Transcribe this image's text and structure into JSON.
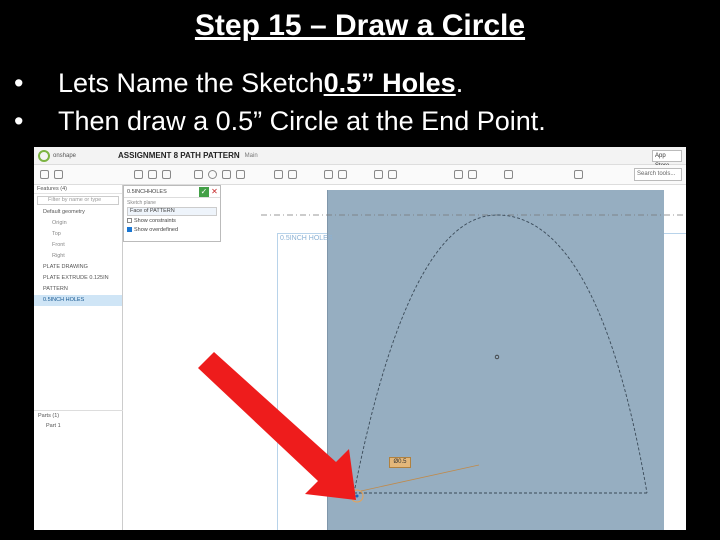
{
  "slide": {
    "title": "Step 15 – Draw a Circle",
    "bullet1_pre": "Lets Name the Sketch ",
    "bullet1_strong": "0.5” Holes",
    "bullet1_post": ".",
    "bullet2": "Then draw a 0.5” Circle at the End Point.",
    "bullet_symbol": "•"
  },
  "app": {
    "logo_text": "onshape",
    "doc_title": "ASSIGNMENT 8 PATH PATTERN",
    "workspace": "Main",
    "app_store": "App Store",
    "search_tools": "Search tools..."
  },
  "features": {
    "header": "Features (4)",
    "filter_placeholder": "Filter by name or type",
    "items": [
      "Default geometry",
      "Origin",
      "Top",
      "Front",
      "Right",
      "PLATE DRAWING",
      "PLATE EXTRUDE 0.125IN",
      "PATTERN",
      "0.5INCH HOLES"
    ],
    "parts_header": "Parts (1)",
    "parts": [
      "Part 1"
    ]
  },
  "sketch_dialog": {
    "title": "0.5INCHHOLES",
    "plane_label": "Sketch plane",
    "plane_value": "Face of PATTERN",
    "option1": "Show constraints",
    "option2": "Show overdefined"
  },
  "viewport": {
    "sketch_label": "0.5INCH HOLES",
    "dimension": "Ø0.5"
  },
  "colors": {
    "arrow": "#ee1c1c",
    "plane": "#96aec1",
    "accept": "#43a047"
  }
}
